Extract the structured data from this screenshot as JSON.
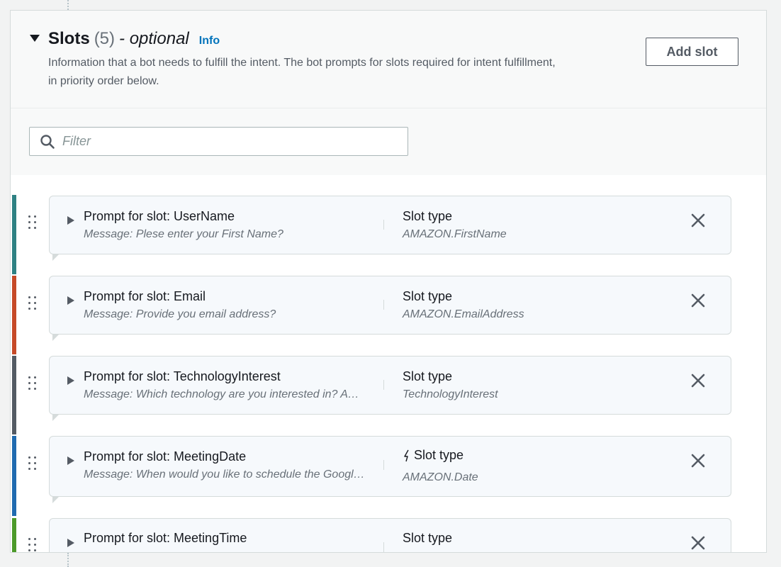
{
  "section": {
    "title": "Slots",
    "count": "(5)",
    "optional": "- optional",
    "info_link": "Info",
    "description": "Information that a bot needs to fulfill the intent. The bot prompts for slots required for intent fulfillment, in priority order below.",
    "add_button": "Add slot"
  },
  "filter": {
    "placeholder": "Filter",
    "value": ""
  },
  "icons": {
    "expand": "caret-down-icon",
    "collapsed": "caret-right-icon",
    "drag": "drag-handle-icon",
    "remove": "close-icon",
    "search": "search-icon",
    "runtime_hint": "lightning-bolt-icon"
  },
  "slots": [
    {
      "name": "Prompt for slot: UserName",
      "message": "Message: Plese enter your First Name?",
      "type_label": "Slot type",
      "type_value": "AMAZON.FirstName",
      "color": "#2e8183"
    },
    {
      "name": "Prompt for slot: Email",
      "message": "Message: Provide you email address?",
      "type_label": "Slot type",
      "type_value": "AMAZON.EmailAddress",
      "color": "#c64a28"
    },
    {
      "name": "Prompt for slot: TechnologyInterest",
      "message": "Message: Which technology are you interested in? AWS, Azure or Google Cloud?",
      "type_label": "Slot type",
      "type_value": "TechnologyInterest",
      "color": "#545b64"
    },
    {
      "name": "Prompt for slot: MeetingDate",
      "message": "Message: When would you like to schedule the Google Meet?",
      "type_label": "Slot type",
      "type_value": "AMAZON.Date",
      "color": "#1f6bb0"
    },
    {
      "name": "Prompt for slot: MeetingTime",
      "message": "",
      "type_label": "Slot type",
      "type_value": "",
      "color": "#4c9a2a"
    }
  ]
}
